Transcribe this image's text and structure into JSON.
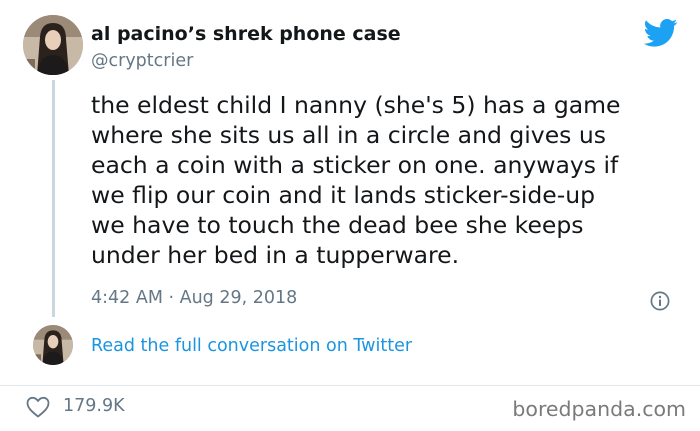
{
  "colors": {
    "text": "#14171a",
    "secondary_text": "#657786",
    "link": "#1b95e0",
    "brand": "#1da1f2",
    "divider": "#e1e8ed",
    "thread_line": "#ccd6dd"
  },
  "author": {
    "display_name": "al pacino’s shrek phone case",
    "handle": "@cryptcrier",
    "avatar_icon": "profile-photo"
  },
  "header": {
    "brand_icon": "twitter-bird-icon"
  },
  "tweet": {
    "lines": [
      "the eldest child I nanny (she's 5) has a game",
      "where she sits us all in a circle and gives us",
      "each a coin with a sticker on one. anyways if",
      "we flip our coin and it lands sticker-side-up",
      "we have to touch the dead bee she keeps",
      "under her bed in a tupperware."
    ],
    "timestamp": "4:42 AM · Aug 29, 2018",
    "info_icon": "info-icon"
  },
  "conversation": {
    "link_text": "Read the full conversation on Twitter"
  },
  "footer": {
    "likes_icon": "heart-icon",
    "likes_count": "179.9K",
    "watermark": "boredpanda.com"
  }
}
